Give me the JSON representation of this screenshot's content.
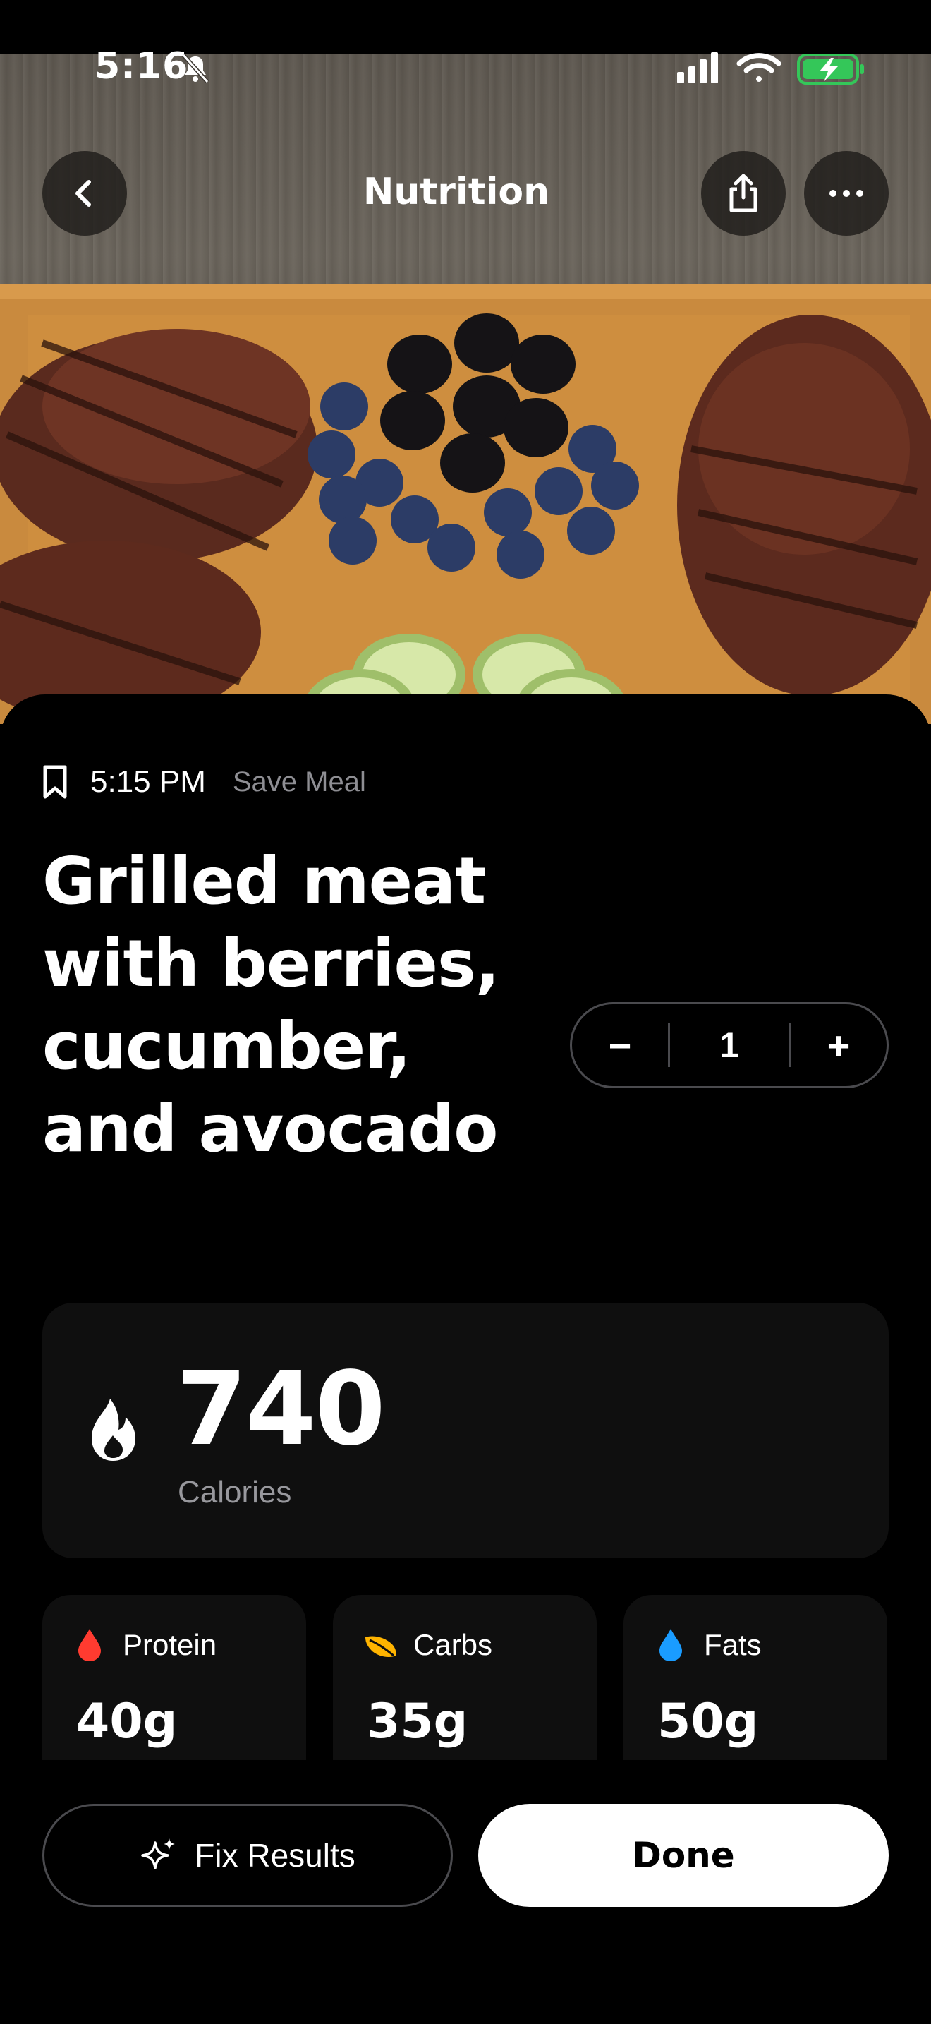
{
  "status_bar": {
    "time": "5:16",
    "silent_icon": "bell-slash-icon",
    "signal_icon": "cellular-signal-icon",
    "wifi_icon": "wifi-icon",
    "battery_icon": "battery-charging-icon",
    "battery_color": "#34c759"
  },
  "nav": {
    "title": "Nutrition",
    "back_icon": "chevron-left-icon",
    "share_icon": "share-icon",
    "more_icon": "ellipsis-icon"
  },
  "hero": {
    "image_icon": "meal-photo"
  },
  "meal": {
    "time": "5:15 PM",
    "save_label": "Save Meal",
    "title": "Grilled meat with berries, cucumber, and avocado",
    "servings": "1",
    "decrement_label": "−",
    "increment_label": "+"
  },
  "calories": {
    "value": "740",
    "label": "Calories"
  },
  "macros": [
    {
      "label": "Protein",
      "value": "40g",
      "icon": "drop-icon",
      "color": "#ff3b30"
    },
    {
      "label": "Carbs",
      "value": "35g",
      "icon": "leaf-icon",
      "color": "#ffb400"
    },
    {
      "label": "Fats",
      "value": "50g",
      "icon": "drop-icon",
      "color": "#1a9cff"
    }
  ],
  "actions": {
    "fix_label": "Fix Results",
    "done_label": "Done"
  }
}
